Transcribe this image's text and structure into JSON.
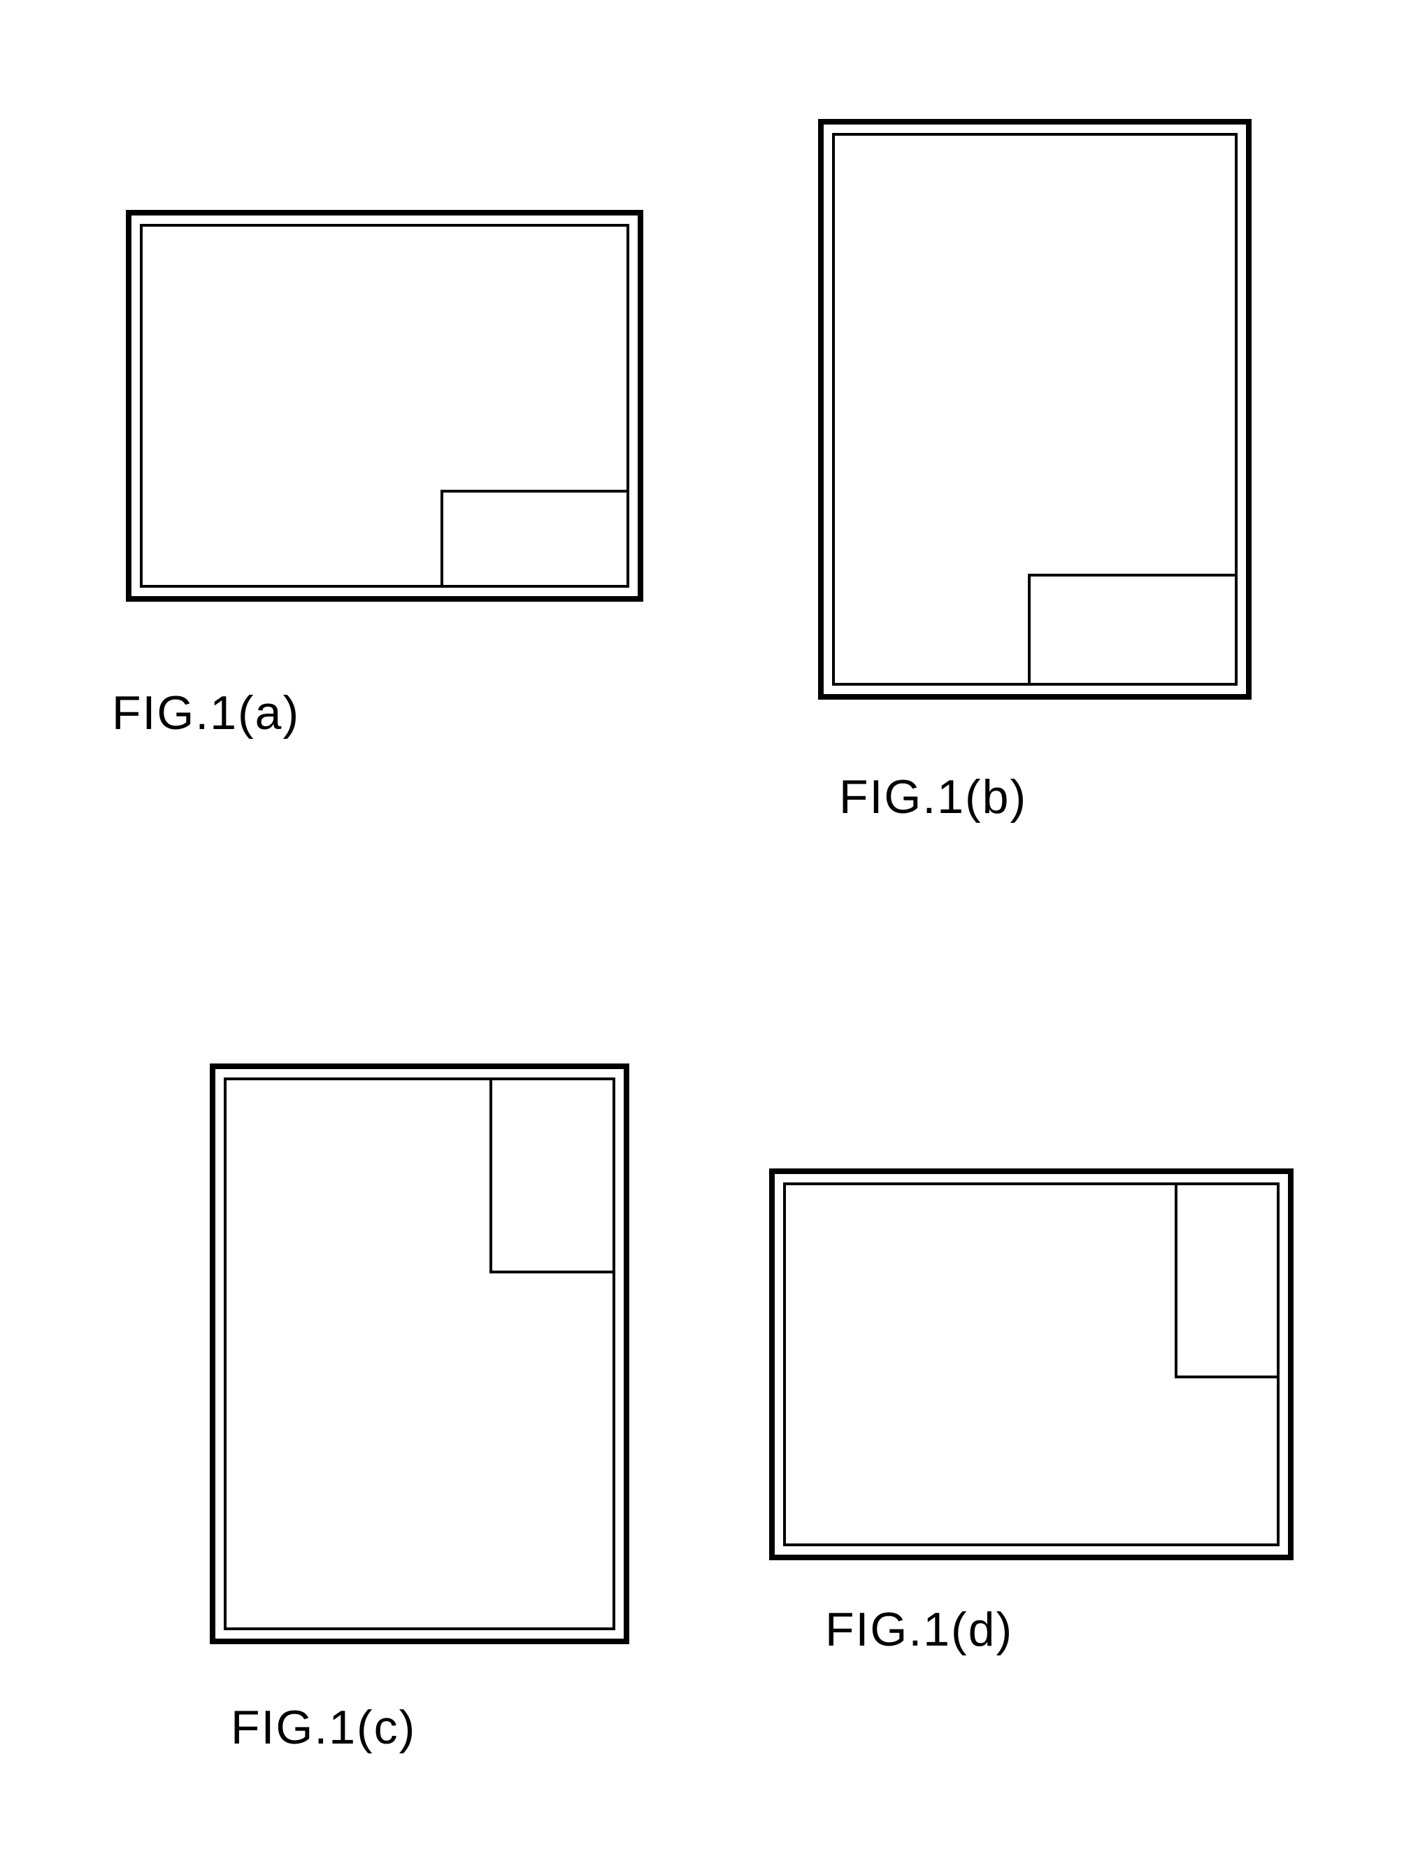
{
  "figures": {
    "a": {
      "label": "FIG.1(a)",
      "orientation": "landscape",
      "inset_position": "bottom-right",
      "inset_orientation": "landscape"
    },
    "b": {
      "label": "FIG.1(b)",
      "orientation": "portrait",
      "inset_position": "bottom-right",
      "inset_orientation": "landscape"
    },
    "c": {
      "label": "FIG.1(c)",
      "orientation": "portrait",
      "inset_position": "top-right",
      "inset_orientation": "portrait"
    },
    "d": {
      "label": "FIG.1(d)",
      "orientation": "landscape",
      "inset_position": "top-right",
      "inset_orientation": "portrait"
    }
  }
}
